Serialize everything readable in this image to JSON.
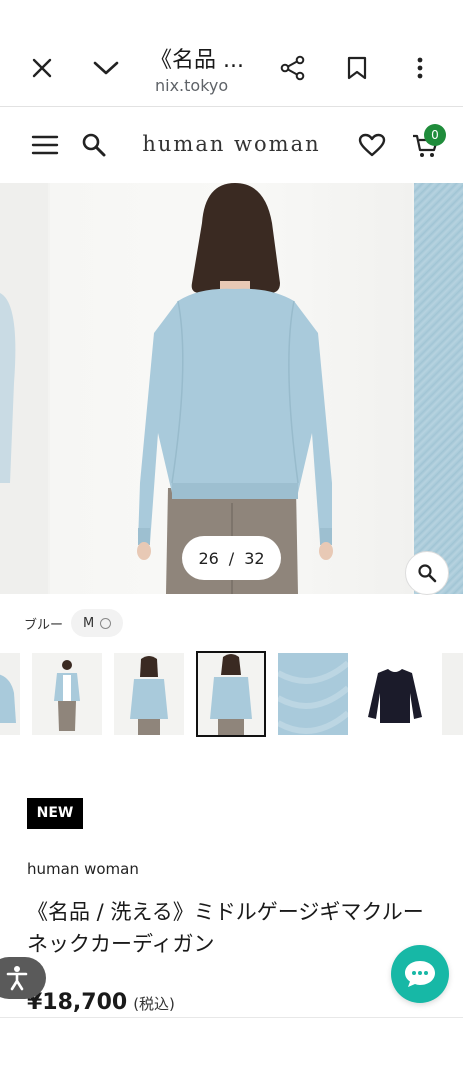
{
  "browser": {
    "title": "《名品 ...",
    "url": "nix.tokyo"
  },
  "site": {
    "logo": "human woman",
    "cart_count": "0"
  },
  "gallery": {
    "current": "26",
    "separator": "/",
    "total": "32"
  },
  "variant": {
    "color_label": "ブルー",
    "size_label": "M"
  },
  "product": {
    "badge": "NEW",
    "brand": "human woman",
    "name": "《名品 / 洗える》ミドルゲージギマクルーネックカーディガン",
    "price": "¥18,700",
    "tax_note": "(税込)"
  },
  "colors": {
    "accent": "#17b8a6",
    "cart_badge": "#1f8c3b",
    "cardigan": "#a9cadb"
  },
  "icons": [
    "close-icon",
    "chevron-down-icon",
    "share-icon",
    "bookmark-icon",
    "more-vert-icon",
    "menu-icon",
    "search-icon",
    "heart-icon",
    "cart-icon",
    "zoom-icon",
    "accessibility-icon",
    "chat-icon"
  ]
}
